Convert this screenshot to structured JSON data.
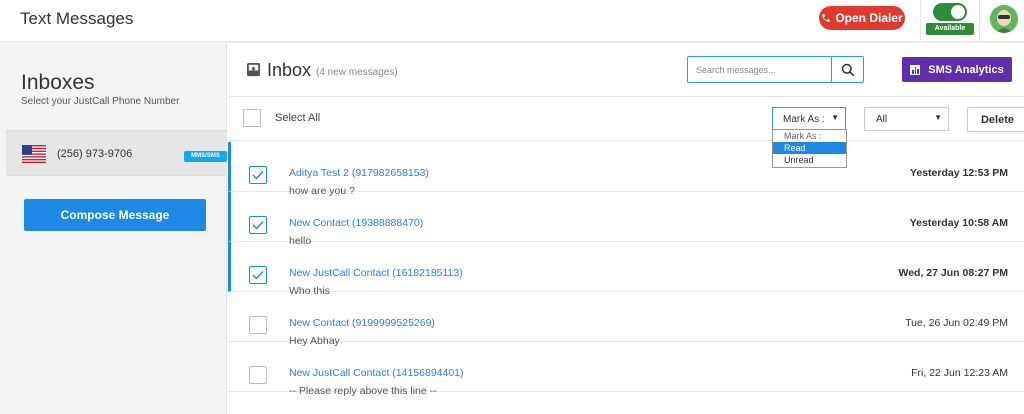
{
  "header": {
    "title": "Text Messages",
    "dialer_label": "Open Dialer",
    "status_label": "Available",
    "colors": {
      "dialer": "#e03a2f",
      "available": "#2e8b3a"
    }
  },
  "sidebar": {
    "title": "Inboxes",
    "subtitle": "Select your JustCall Phone Number",
    "inbox": {
      "phone": "(256) 973-9706",
      "badge": "MMS/SMS",
      "flag_icon": "us-flag-icon"
    },
    "compose_label": "Compose Message",
    "colors": {
      "compose": "#1e88e5",
      "badge": "#11a9e8"
    }
  },
  "main": {
    "title": "Inbox",
    "new_count": "(4 new messages)",
    "search": {
      "placeholder": "Search messages..."
    },
    "analytics_label": "SMS Analytics",
    "colors": {
      "analytics": "#5f2ea8",
      "link": "#2b80d6"
    },
    "toolbar": {
      "select_all": "Select All",
      "mark_as": "Mark As :",
      "mark_options": [
        "Mark As :",
        "Read",
        "Unread"
      ],
      "mark_selected_option": "Read",
      "filter": "All",
      "delete": "Delete"
    },
    "messages": [
      {
        "name": "Aditya Test 2 (917982658153)",
        "text": "how are you ?",
        "time": "Yesterday 12:53 PM",
        "checked": true,
        "unread": true
      },
      {
        "name": "New Contact (19388888470)",
        "text": "hello",
        "time": "Yesterday 10:58 AM",
        "checked": true,
        "unread": true
      },
      {
        "name": "New JustCall Contact (16182185113)",
        "text": "Who this",
        "time": "Wed, 27 Jun 08:27 PM",
        "checked": true,
        "unread": true
      },
      {
        "name": "New Contact (9199999525269)",
        "text": "Hey Abhay",
        "time": "Tue, 26 Jun 02:49 PM",
        "checked": false,
        "unread": false
      },
      {
        "name": "New JustCall Contact (14156894401)",
        "text": "-- Please reply above this line --",
        "time": "Fri, 22 Jun 12:23 AM",
        "checked": false,
        "unread": false
      }
    ]
  }
}
